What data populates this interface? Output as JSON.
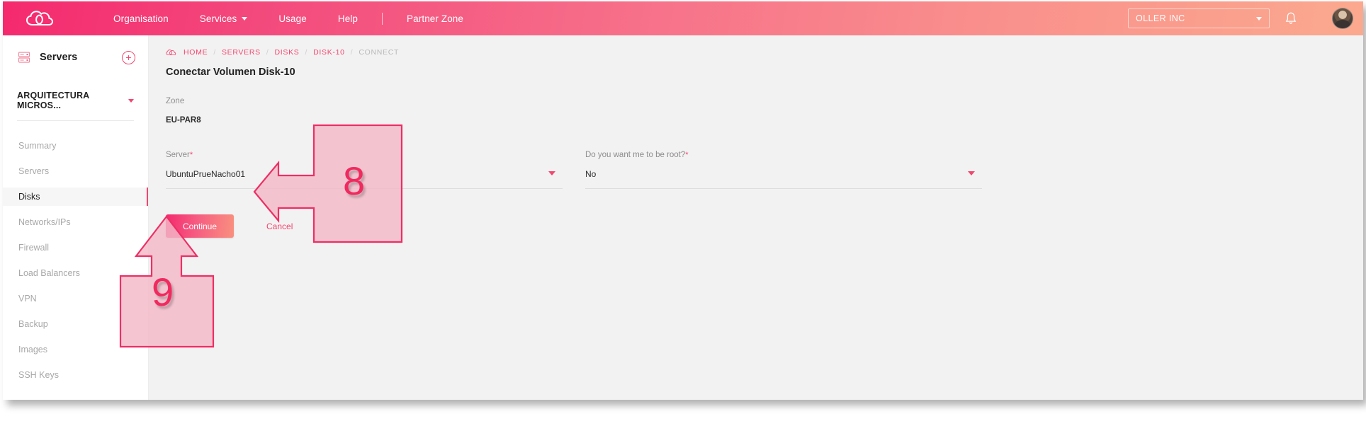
{
  "navbar": {
    "logo_icon": "cloud-logo-icon",
    "items": [
      {
        "label": "Organisation",
        "has_caret": false
      },
      {
        "label": "Services",
        "has_caret": true
      },
      {
        "label": "Usage",
        "has_caret": false
      },
      {
        "label": "Help",
        "has_caret": false
      },
      {
        "label": "Partner Zone",
        "has_caret": false
      }
    ],
    "organisation_select": "OLLER INC",
    "bell_icon": "notification-bell-icon",
    "avatar_icon": "user-avatar"
  },
  "sidebar": {
    "section_title": "Servers",
    "section_icon": "server-rack-icon",
    "add_button_label": "+",
    "project_name": "ARQUITECTURA MICROS...",
    "items": [
      {
        "label": "Summary",
        "active": false
      },
      {
        "label": "Servers",
        "active": false
      },
      {
        "label": "Disks",
        "active": true
      },
      {
        "label": "Networks/IPs",
        "active": false
      },
      {
        "label": "Firewall",
        "active": false
      },
      {
        "label": "Load Balancers",
        "active": false
      },
      {
        "label": "VPN",
        "active": false
      },
      {
        "label": "Backup",
        "active": false
      },
      {
        "label": "Images",
        "active": false
      },
      {
        "label": "SSH Keys",
        "active": false
      }
    ]
  },
  "breadcrumb": {
    "icon": "cloud-icon",
    "items": [
      {
        "label": "HOME",
        "current": false
      },
      {
        "label": "SERVERS",
        "current": false
      },
      {
        "label": "DISKS",
        "current": false
      },
      {
        "label": "DISK-10",
        "current": false
      },
      {
        "label": "CONNECT",
        "current": true
      }
    ],
    "separator": "/"
  },
  "main": {
    "page_title": "Conectar Volumen Disk-10",
    "zone": {
      "label": "Zone",
      "value": "EU-PAR8"
    },
    "server_field": {
      "label": "Server",
      "required_mark": "*",
      "value": "UbuntuPrueNacho01"
    },
    "root_field": {
      "label": "Do you want me to be root?",
      "required_mark": "*",
      "value": "No"
    },
    "continue_button": "Continue",
    "cancel_button": "Cancel"
  },
  "annotations": [
    {
      "number": "8",
      "target": "server-select",
      "direction": "left"
    },
    {
      "number": "9",
      "target": "continue-button",
      "direction": "up"
    }
  ],
  "colors": {
    "accent_pink": "#f2466f",
    "navbar_gradient_start": "#f5296e",
    "navbar_gradient_end": "#fba98e",
    "annotation_stroke": "#ee2e64",
    "annotation_fill": "#f3b9c8",
    "content_bg": "#f2f2f2"
  }
}
